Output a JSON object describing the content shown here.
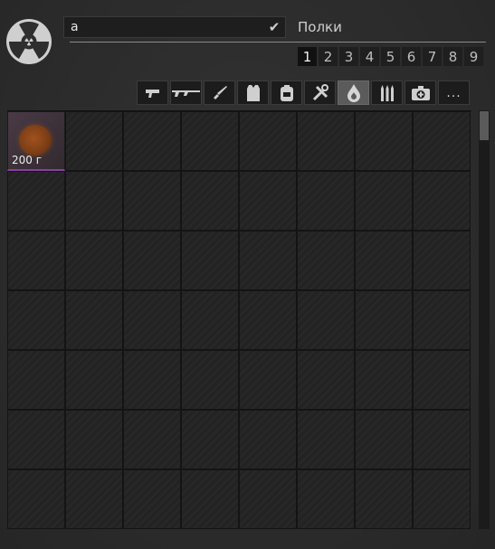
{
  "search": {
    "value": "а"
  },
  "shelves": {
    "label": "Полки",
    "pages": [
      "1",
      "2",
      "3",
      "4",
      "5",
      "6",
      "7",
      "8",
      "9"
    ],
    "active_page": "1"
  },
  "filters": [
    {
      "name": "pistol-icon"
    },
    {
      "name": "rifle-icon"
    },
    {
      "name": "knife-icon"
    },
    {
      "name": "armor-vest-icon"
    },
    {
      "name": "backpack-icon"
    },
    {
      "name": "tools-icon"
    },
    {
      "name": "artifact-icon",
      "active": true
    },
    {
      "name": "ammo-icon"
    },
    {
      "name": "medkit-icon"
    },
    {
      "name": "more-icon",
      "label": "..."
    }
  ],
  "inventory": {
    "item": {
      "icon": "brown-blob-icon",
      "qty": "200 г",
      "rarity_color": "#8a3fa0"
    }
  }
}
